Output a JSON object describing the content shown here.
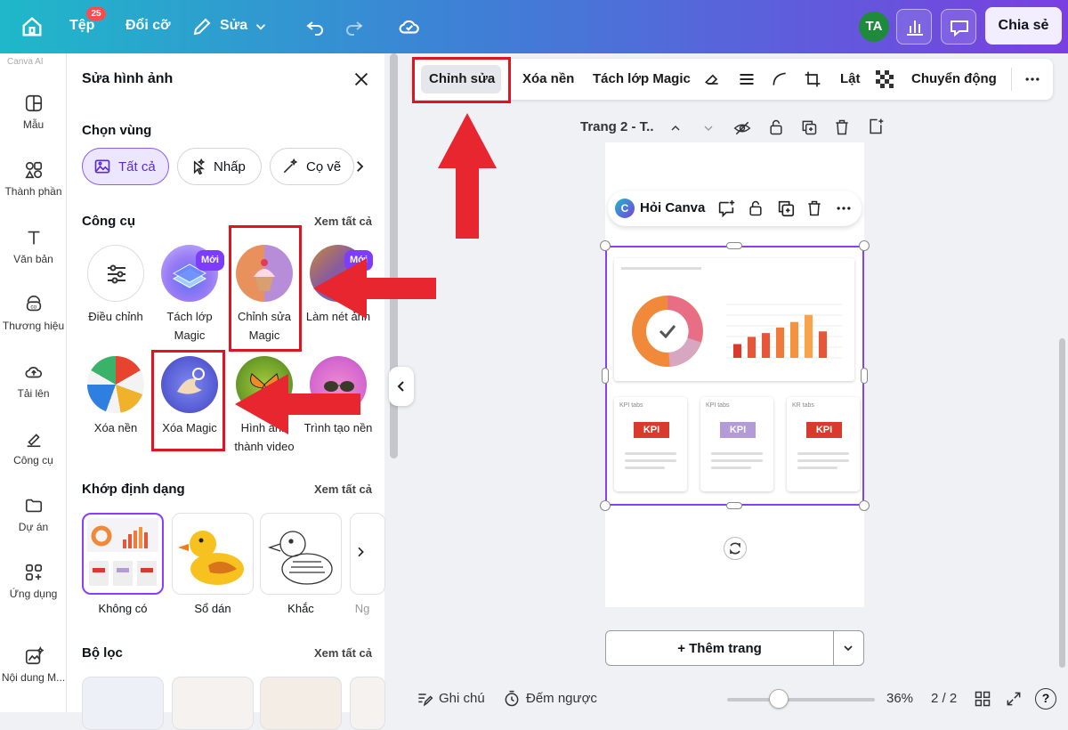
{
  "topbar": {
    "file_label": "Tệp",
    "file_badge": "25",
    "resize_label": "Đổi cỡ",
    "edit_label": "Sửa",
    "avatar_initials": "TA",
    "share_label": "Chia sẻ"
  },
  "leftnav": {
    "faded_label": "Canva AI",
    "items": [
      {
        "label": "Mẫu",
        "icon": "template-icon"
      },
      {
        "label": "Thành phần",
        "icon": "elements-icon"
      },
      {
        "label": "Văn bản",
        "icon": "text-icon"
      },
      {
        "label": "Thương hiệu",
        "icon": "brand-icon"
      },
      {
        "label": "Tải lên",
        "icon": "upload-icon"
      },
      {
        "label": "Công cụ",
        "icon": "tools-icon"
      },
      {
        "label": "Dự án",
        "icon": "folder-icon"
      },
      {
        "label": "Ứng dụng",
        "icon": "apps-icon"
      },
      {
        "label": "Nội dung M...",
        "icon": "magic-media-icon"
      }
    ]
  },
  "panel": {
    "title": "Sửa hình ảnh",
    "select_area": {
      "title": "Chọn vùng",
      "chips": [
        "Tất cả",
        "Nhấp",
        "Cọ vẽ"
      ]
    },
    "tools": {
      "title": "Công cụ",
      "see_all": "Xem tất cả",
      "items": [
        {
          "label": "Điều chỉnh",
          "badge": ""
        },
        {
          "label": "Tách lớp Magic",
          "badge": "Mới"
        },
        {
          "label": "Chỉnh sửa Magic",
          "badge": ""
        },
        {
          "label": "Làm nét ảnh",
          "badge": "Mới"
        },
        {
          "label": "Xóa nền",
          "badge": ""
        },
        {
          "label": "Xóa Magic",
          "badge": ""
        },
        {
          "label": "Hình ảnh thành video",
          "badge": ""
        },
        {
          "label": "Trình tạo nền",
          "badge": ""
        }
      ]
    },
    "style_match": {
      "title": "Khớp định dạng",
      "see_all": "Xem tất cả",
      "items": [
        "Không có",
        "Sổ dán",
        "Khắc",
        "Ng"
      ]
    },
    "filters": {
      "title": "Bộ lọc",
      "see_all": "Xem tất cả"
    }
  },
  "context_bar": {
    "items": [
      "Chỉnh sửa",
      "Xóa nền",
      "Tách lớp Magic",
      "Lật",
      "Chuyển động"
    ]
  },
  "canvas": {
    "page_title": "Trang 2 - T..",
    "ask_canva": "Hỏi Canva",
    "kpi_cards": [
      {
        "title": "KPI tabs",
        "tag": "KPI",
        "color": "#d93a2b"
      },
      {
        "title": "KPI tabs",
        "tag": "KPI",
        "color": "#b39ad8"
      },
      {
        "title": "KR tabs",
        "tag": "KPI",
        "color": "#d93a2b"
      }
    ],
    "chart_bars": [
      {
        "color": "#d93a2b",
        "value": 0.25
      },
      {
        "color": "#e8563a",
        "value": 0.38
      },
      {
        "color": "#e8563a",
        "value": 0.45
      },
      {
        "color": "#f07a3a",
        "value": 0.55
      },
      {
        "color": "#f4923d",
        "value": 0.65
      },
      {
        "color": "#f9a448",
        "value": 0.78
      },
      {
        "color": "#e8563a",
        "value": 0.48
      }
    ],
    "add_page": "+ Thêm trang"
  },
  "bottombar": {
    "notes": "Ghi chú",
    "timer": "Đếm ngược",
    "zoom": "36%",
    "page_count": "2 / 2"
  }
}
